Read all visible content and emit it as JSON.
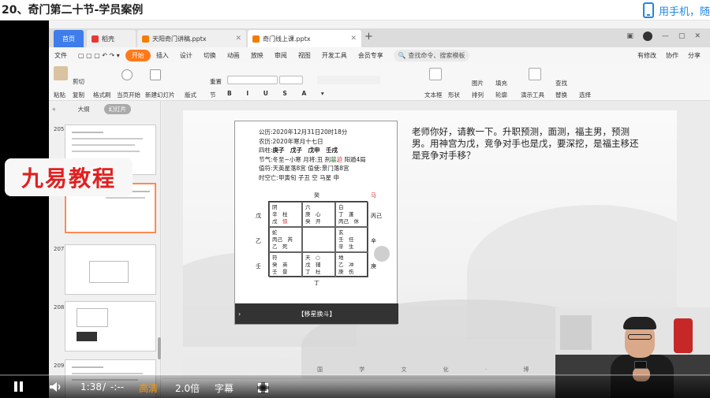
{
  "header": {
    "title": "20、奇门第二十节-学员案例",
    "phone_text": "用手机，随"
  },
  "app": {
    "tabs": [
      {
        "label": "首页"
      },
      {
        "label": "稻壳"
      },
      {
        "label": "天阳奇门讲稿.pptx"
      },
      {
        "label": "奇门线上课.pptx"
      }
    ],
    "menu": [
      "文件",
      "开始",
      "插入",
      "设计",
      "切换",
      "动画",
      "放映",
      "审阅",
      "视图",
      "开发工具",
      "会员专享"
    ],
    "search_placeholder": "查找命令、搜索模板",
    "menu_right": [
      "有修改",
      "协作",
      "分享"
    ],
    "ribbon": {
      "paste": "粘贴",
      "cut": "剪切",
      "copy": "复制",
      "format_painter": "格式刷",
      "play": "当页开始",
      "new_slide": "新建幻灯片",
      "layout": "版式",
      "section": "节",
      "reset": "重置",
      "textbox": "文本框",
      "shape": "形状",
      "arrange": "排列",
      "outline": "轮廓",
      "picture": "图片",
      "fill": "填充",
      "find": "查找",
      "replace": "替换",
      "select": "选择",
      "presenter": "演示工具"
    }
  },
  "thumbs": {
    "tab_outline": "大纲",
    "tab_slides": "幻灯片",
    "nums": [
      "205",
      "206",
      "207",
      "208",
      "209"
    ]
  },
  "watermark": "九易教程",
  "slide": {
    "question": "老师你好，请教一下。升职预测，面测，福主男，预测男。用神宫为戊，竞争对手也是戊，要深挖，是福主移还是竞争对手移？",
    "footer": "国 学 文 化 · 博 大 精 深",
    "card": {
      "lines": [
        "公历:2020年12月31日20时18分",
        "农历:2020年寒月十七日"
      ],
      "pillars_label": "四柱:",
      "pillars": "庚子　戊子　戊申　壬戌",
      "jieqi_prefix": "节气:冬至~小寒 月将:丑 刑",
      "jieqi_red1": "墓",
      "jieqi_red2": "迫",
      "jieqi_suffix": " 阳遁4局",
      "zhifu": "值符:天英星落8宫 值使:景门落8宫",
      "kong": "时空亡:甲寅旬 子丑 空 马星 申",
      "top_label": "癸",
      "top_mark": "马",
      "bottom_label": "丁",
      "left_labels": [
        "戊",
        "乙",
        "壬"
      ],
      "right_labels": [
        "丙己",
        "辛",
        "庚"
      ],
      "cells": [
        [
          "阴",
          "辛　柱",
          "戊　",
          "惊"
        ],
        [
          "六",
          "庚　心",
          "癸　开"
        ],
        [
          "白",
          "丁　蓬",
          "丙己　休"
        ],
        [
          "蛇",
          "丙己　芮",
          "乙　死"
        ],
        [],
        [
          "玄",
          "壬　任",
          "辛　生"
        ],
        [
          "符",
          "癸　英",
          "壬　景"
        ],
        [
          "天　○",
          "戊　辅",
          "丁　杜"
        ],
        [
          "地",
          "乙　冲",
          "庚　伤"
        ]
      ],
      "button": "【移星换斗】"
    }
  },
  "player": {
    "time": "1:38",
    "sep": "/",
    "duration": "-:--",
    "quality": "高清",
    "speed": "2.0倍",
    "subtitle": "字幕",
    "progress": 0.0
  }
}
